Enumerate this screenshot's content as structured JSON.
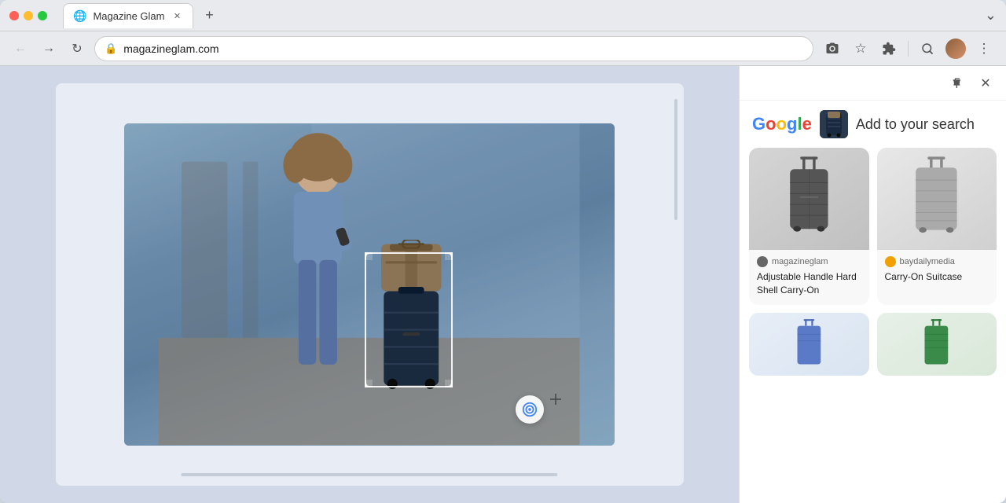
{
  "browser": {
    "tab_title": "Magazine Glam",
    "tab_favicon": "M",
    "url": "magazineglam.com",
    "new_tab_icon": "+"
  },
  "panel": {
    "search_title": "Add to your search",
    "pin_icon": "📌",
    "close_icon": "✕"
  },
  "products": [
    {
      "id": "product-1",
      "source": "magazineglam",
      "source_color": "#666",
      "title": "Adjustable Handle Hard Shell Carry-On",
      "type": "charcoal-suitcase"
    },
    {
      "id": "product-2",
      "source": "baydailymedia",
      "source_color": "#f0a000",
      "title": "Carry-On Suitcase",
      "type": "grey-suitcase"
    },
    {
      "id": "product-3",
      "source": "",
      "source_color": "#4285f4",
      "title": "",
      "type": "blue-suitcase"
    },
    {
      "id": "product-4",
      "source": "",
      "source_color": "#34a853",
      "title": "",
      "type": "green-suitcase"
    }
  ],
  "google": {
    "g": "G",
    "letters": [
      "G",
      "o",
      "o",
      "g",
      "l",
      "e"
    ]
  }
}
